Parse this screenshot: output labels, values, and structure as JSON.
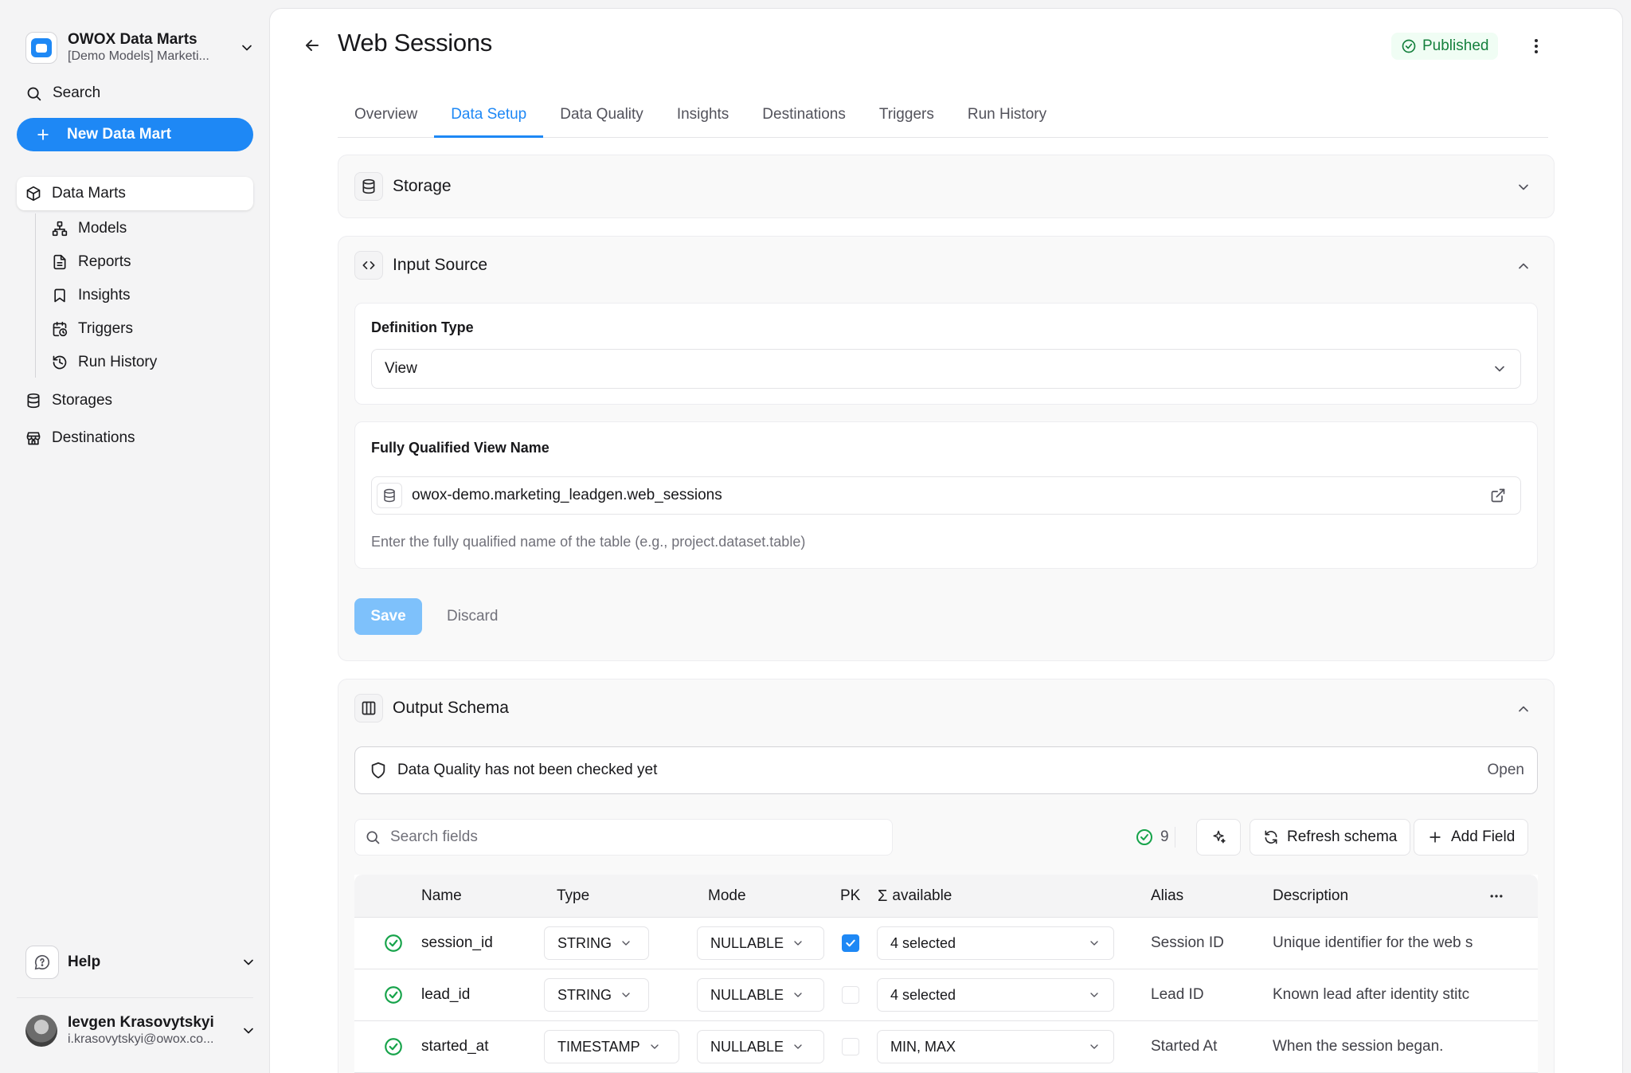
{
  "sidebar": {
    "app_title": "OWOX Data Marts",
    "app_subtitle": "[Demo Models] Marketi...",
    "search_label": "Search",
    "new_button_label": "New Data Mart",
    "nav": {
      "data_marts": "Data Marts",
      "models": "Models",
      "reports": "Reports",
      "insights": "Insights",
      "triggers": "Triggers",
      "run_history": "Run History",
      "storages": "Storages",
      "destinations": "Destinations"
    },
    "help_label": "Help",
    "user": {
      "name": "Ievgen Krasovytskyi",
      "email": "i.krasovytskyi@owox.co..."
    }
  },
  "header": {
    "title": "Web Sessions",
    "status": "Published"
  },
  "tabs": [
    "Overview",
    "Data Setup",
    "Data Quality",
    "Insights",
    "Destinations",
    "Triggers",
    "Run History"
  ],
  "active_tab": "Data Setup",
  "storage": {
    "title": "Storage"
  },
  "input_source": {
    "title": "Input Source",
    "definition_type_label": "Definition Type",
    "definition_type_value": "View",
    "fqn_label": "Fully Qualified View Name",
    "fqn_value": "owox-demo.marketing_leadgen.web_sessions",
    "fqn_hint": "Enter the fully qualified name of the table (e.g., project.dataset.table)",
    "save_label": "Save",
    "discard_label": "Discard"
  },
  "output_schema": {
    "title": "Output Schema",
    "dq_message": "Data Quality has not been checked yet",
    "dq_open_label": "Open",
    "search_placeholder": "Search fields",
    "field_count": "9",
    "refresh_label": "Refresh schema",
    "add_field_label": "Add Field",
    "columns": {
      "name": "Name",
      "type": "Type",
      "mode": "Mode",
      "pk": "PK",
      "agg": "available",
      "alias": "Alias",
      "description": "Description"
    },
    "rows": [
      {
        "name": "session_id",
        "type": "STRING",
        "mode": "NULLABLE",
        "pk": true,
        "agg": "4 selected",
        "alias": "Session ID",
        "description": "Unique identifier for the web s"
      },
      {
        "name": "lead_id",
        "type": "STRING",
        "mode": "NULLABLE",
        "pk": false,
        "agg": "4 selected",
        "alias": "Lead ID",
        "description": "Known lead after identity stitc"
      },
      {
        "name": "started_at",
        "type": "TIMESTAMP",
        "mode": "NULLABLE",
        "pk": false,
        "agg": "MIN, MAX",
        "alias": "Started At",
        "description": "When the session began."
      }
    ]
  },
  "colors": {
    "accent": "#1e88f5",
    "success": "#16a34a",
    "published_bg": "#f0fdf4",
    "save_disabled": "#7ec1fb"
  }
}
